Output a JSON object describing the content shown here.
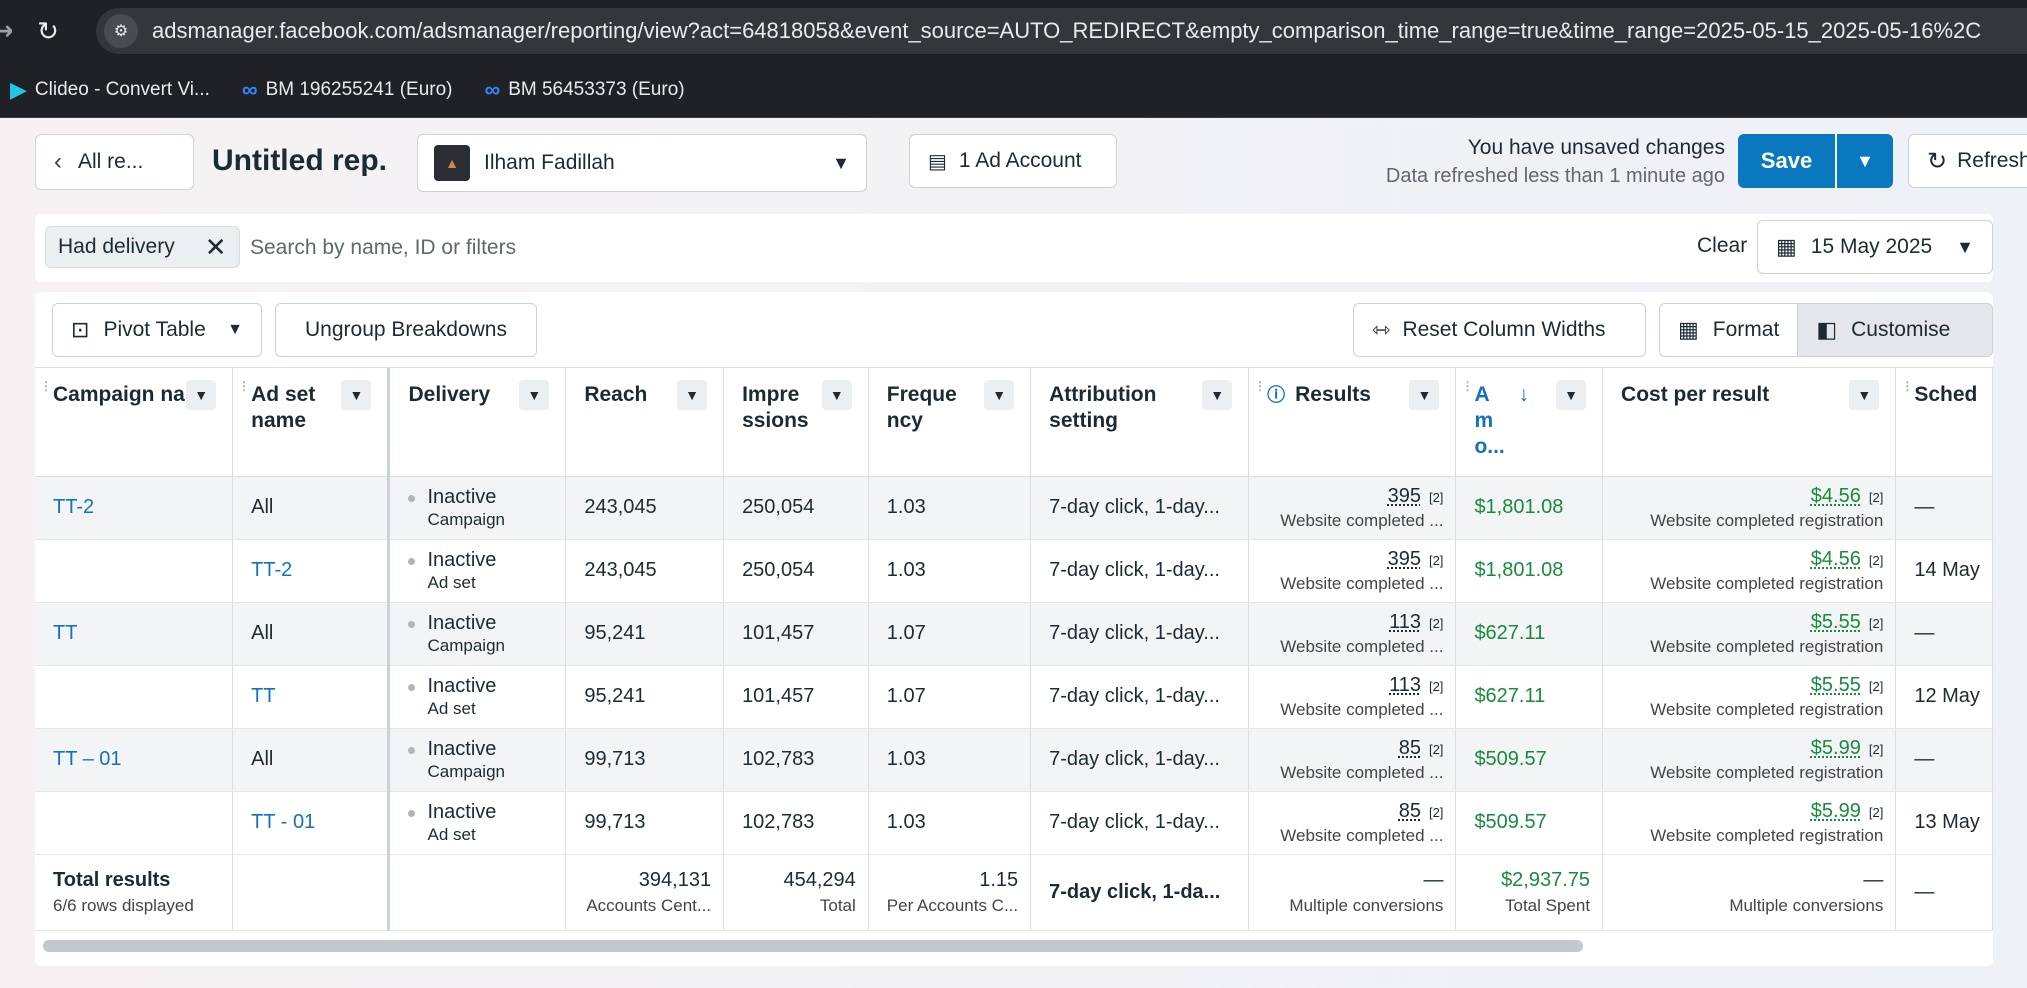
{
  "browser": {
    "url": "adsmanager.facebook.com/adsmanager/reporting/view?act=64818058&event_source=AUTO_REDIRECT&empty_comparison_time_range=true&time_range=2025-05-15_2025-05-16%2C",
    "bookmarks": [
      {
        "label": "Clideo - Convert Vi...",
        "icon": "clideo-icon"
      },
      {
        "label": "BM 196255241 (Euro)",
        "icon": "meta-icon"
      },
      {
        "label": "BM 56453373 (Euro)",
        "icon": "meta-icon"
      }
    ]
  },
  "header": {
    "all_reports": "All re...",
    "title": "Untitled rep.",
    "account_name": "Ilham Fadillah",
    "ad_account": "1 Ad Account",
    "unsaved": "You have unsaved changes",
    "refreshed": "Data refreshed less than 1 minute ago",
    "save": "Save",
    "refresh": "Refresh"
  },
  "filters": {
    "chip": "Had delivery",
    "search_placeholder": "Search by name, ID or filters",
    "clear": "Clear",
    "date": "15 May 2025"
  },
  "toolbar": {
    "pivot": "Pivot Table",
    "ungroup": "Ungroup Breakdowns",
    "reset": "Reset Column Widths",
    "format": "Format",
    "customise": "Customise"
  },
  "columns": {
    "campaign": "Campaign name",
    "adset": "Ad set name",
    "delivery": "Delivery",
    "reach": "Reach",
    "impressions": "Impre ssions",
    "frequency": "Freque ncy",
    "attribution": "Attribution setting",
    "results": "Results",
    "amount": "A m o...",
    "cost": "Cost per result",
    "schedule": "Sched"
  },
  "rows": [
    {
      "campaign": "TT-2",
      "adset": "All",
      "status": "Inactive",
      "level": "Campaign",
      "reach": "243,045",
      "impressions": "250,054",
      "frequency": "1.03",
      "attribution": "7-day click, 1-day...",
      "results": "395",
      "results_note": "[2]",
      "results_sub": "Website completed ...",
      "amount": "$1,801.08",
      "cost": "$4.56",
      "cost_note": "[2]",
      "cost_sub": "Website completed registration",
      "schedule": "—"
    },
    {
      "campaign": "",
      "adset": "TT-2",
      "status": "Inactive",
      "level": "Ad set",
      "reach": "243,045",
      "impressions": "250,054",
      "frequency": "1.03",
      "attribution": "7-day click, 1-day...",
      "results": "395",
      "results_note": "[2]",
      "results_sub": "Website completed ...",
      "amount": "$1,801.08",
      "cost": "$4.56",
      "cost_note": "[2]",
      "cost_sub": "Website completed registration",
      "schedule": "14 May"
    },
    {
      "campaign": "TT",
      "adset": "All",
      "status": "Inactive",
      "level": "Campaign",
      "reach": "95,241",
      "impressions": "101,457",
      "frequency": "1.07",
      "attribution": "7-day click, 1-day...",
      "results": "113",
      "results_note": "[2]",
      "results_sub": "Website completed ...",
      "amount": "$627.11",
      "cost": "$5.55",
      "cost_note": "[2]",
      "cost_sub": "Website completed registration",
      "schedule": "—"
    },
    {
      "campaign": "",
      "adset": "TT",
      "status": "Inactive",
      "level": "Ad set",
      "reach": "95,241",
      "impressions": "101,457",
      "frequency": "1.07",
      "attribution": "7-day click, 1-day...",
      "results": "113",
      "results_note": "[2]",
      "results_sub": "Website completed ...",
      "amount": "$627.11",
      "cost": "$5.55",
      "cost_note": "[2]",
      "cost_sub": "Website completed registration",
      "schedule": "12 May"
    },
    {
      "campaign": "TT – 01",
      "adset": "All",
      "status": "Inactive",
      "level": "Campaign",
      "reach": "99,713",
      "impressions": "102,783",
      "frequency": "1.03",
      "attribution": "7-day click, 1-day...",
      "results": "85",
      "results_note": "[2]",
      "results_sub": "Website completed ...",
      "amount": "$509.57",
      "cost": "$5.99",
      "cost_note": "[2]",
      "cost_sub": "Website completed registration",
      "schedule": "—"
    },
    {
      "campaign": "",
      "adset": "TT - 01",
      "status": "Inactive",
      "level": "Ad set",
      "reach": "99,713",
      "impressions": "102,783",
      "frequency": "1.03",
      "attribution": "7-day click, 1-day...",
      "results": "85",
      "results_note": "[2]",
      "results_sub": "Website completed ...",
      "amount": "$509.57",
      "cost": "$5.99",
      "cost_note": "[2]",
      "cost_sub": "Website completed registration",
      "schedule": "13 May"
    }
  ],
  "totals": {
    "title": "Total results",
    "rows_displayed": "6/6 rows displayed",
    "reach": "394,131",
    "reach_label": "Accounts Cent...",
    "impressions": "454,294",
    "impressions_label": "Total",
    "frequency": "1.15",
    "frequency_label": "Per Accounts C...",
    "attribution": "7-day click, 1-da...",
    "results": "—",
    "results_label": "Multiple conversions",
    "amount": "$2,937.75",
    "amount_label": "Total Spent",
    "cost": "—",
    "cost_label": "Multiple conversions",
    "schedule": "—"
  }
}
